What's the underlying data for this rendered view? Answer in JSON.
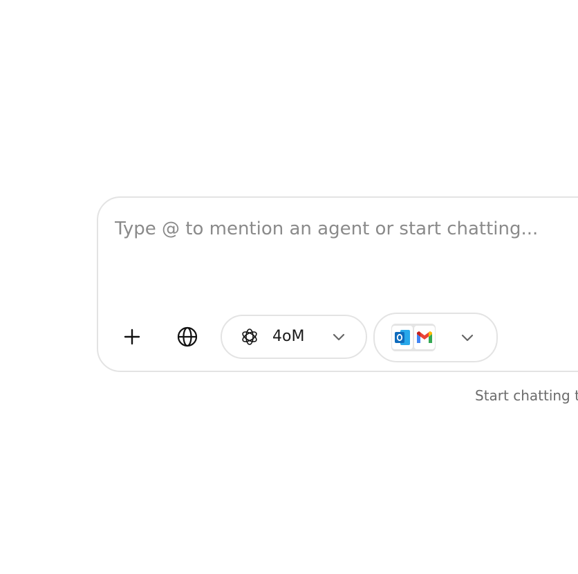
{
  "composer": {
    "placeholder": "Type @ to mention an agent or start chatting...",
    "value": ""
  },
  "toolbar": {
    "add_icon": "plus-icon",
    "web_icon": "globe-icon",
    "model": {
      "label": "4oM",
      "icon": "openai-logo-icon"
    },
    "connectors": {
      "apps": [
        "outlook-icon",
        "gmail-icon"
      ]
    }
  },
  "footer": {
    "note": "Start chatting t"
  },
  "colors": {
    "border": "#e3e3e3",
    "placeholder": "#8a8a8a",
    "outlook_blue": "#0f6cbd",
    "gmail_red": "#ea4335",
    "gmail_blue": "#4285f4",
    "gmail_green": "#34a853",
    "gmail_yellow": "#fbbc04"
  }
}
